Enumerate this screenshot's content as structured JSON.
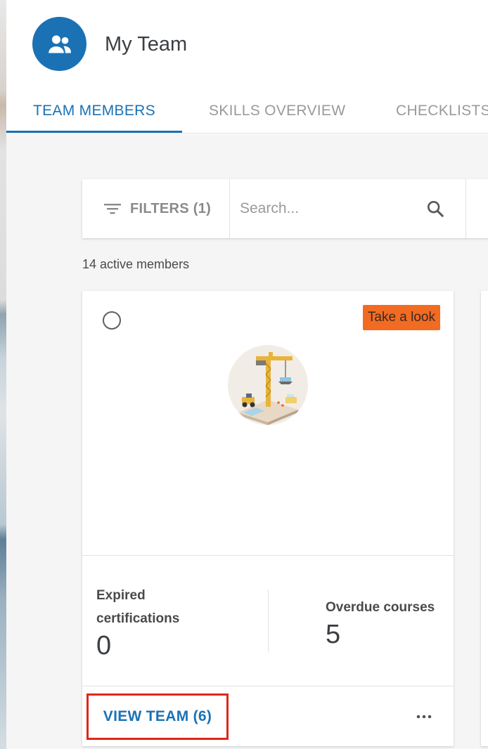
{
  "header": {
    "title": "My Team",
    "avatar_icon": "people-icon",
    "accent_color": "#1a72b5"
  },
  "tabs": [
    {
      "label": "TEAM MEMBERS",
      "active": true
    },
    {
      "label": "SKILLS OVERVIEW",
      "active": false
    },
    {
      "label": "CHECKLISTS",
      "active": false
    }
  ],
  "toolbar": {
    "filters_label": "FILTERS (1)",
    "filter_icon": "filter-icon",
    "search_placeholder": "Search...",
    "search_value": "",
    "search_icon": "search-icon"
  },
  "members_count": "14 active members",
  "card": {
    "badge_label": "Take a look",
    "badge_color": "#f26b22",
    "illustration_icon": "construction-crane-illustration",
    "stats": [
      {
        "label": "Expired certifications",
        "value": "0"
      },
      {
        "label": "Overdue courses",
        "value": "5"
      }
    ],
    "view_team_label": "VIEW TEAM (6)",
    "more_icon": "more-horizontal-icon"
  }
}
